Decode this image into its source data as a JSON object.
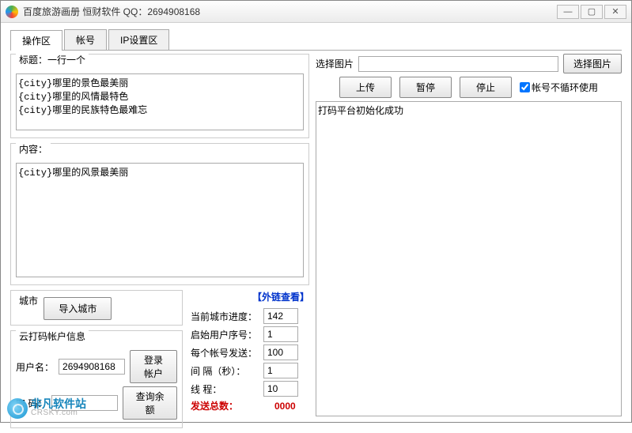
{
  "window": {
    "title": "百度旅游画册  恒财软件 QQ：2694908168"
  },
  "tabs": {
    "t0": "操作区",
    "t1": "帐号",
    "t2": "IP设置区"
  },
  "left": {
    "title_label": "标题：一行一个",
    "title_text": "{city}哪里的景色最美丽\n{city}哪里的风情最特色\n{city}哪里的民族特色最难忘",
    "content_label": "内容：",
    "content_text": "{city}哪里的风景最美丽",
    "city_label": "城市",
    "import_city": "导入城市",
    "yun_info": "云打码帐户信息",
    "user_label": "用户名：",
    "user_value": "2694908168",
    "login_btn": "登录帐户",
    "pwd_label": "密  码：",
    "pwd_value": "",
    "balance_btn": "查询余额",
    "link_view": "【外链查看】",
    "progress_label": "当前城市进度：",
    "progress_value": "142",
    "startuser_label": "启始用户序号：",
    "startuser_value": "1",
    "peraccount_label": "每个帐号发送：",
    "peraccount_value": "100",
    "interval_label": "间  隔（秒）：",
    "interval_value": "1",
    "threads_label": "线          程：",
    "threads_value": "10",
    "total_label": "发送总数：",
    "total_value": "0000"
  },
  "right": {
    "select_img_label": "选择图片",
    "select_img_btn": "选择图片",
    "upload": "上传",
    "pause": "暂停",
    "stop": "停止",
    "noloop": "帐号不循环使用",
    "log_text": "打码平台初始化成功"
  },
  "watermark": {
    "cn": "非凡软件站",
    "en": "CRSKY.com"
  }
}
